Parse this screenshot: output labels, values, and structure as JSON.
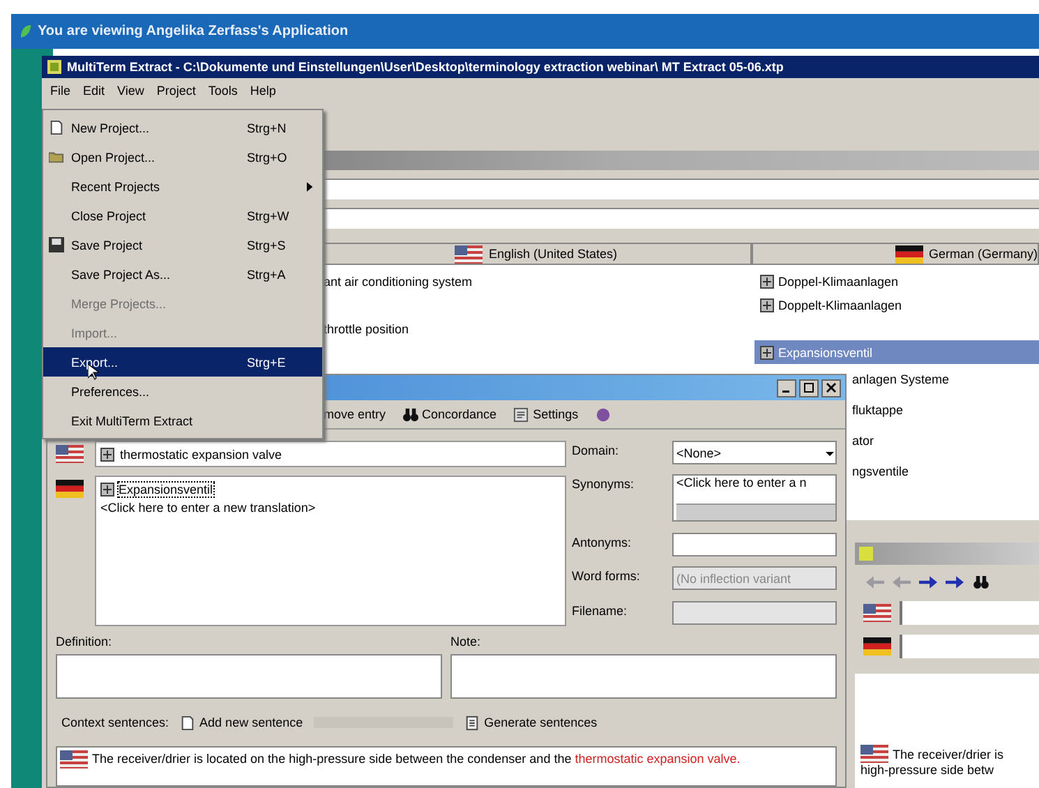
{
  "banner": {
    "title": "You are viewing Angelika Zerfass's Application"
  },
  "window": {
    "title": "MultiTerm Extract - C:\\Dokumente und Einstellungen\\User\\Desktop\\terminology extraction webinar\\ MT Extract 05-06.xtp",
    "menu": [
      "File",
      "Edit",
      "View",
      "Project",
      "Tools",
      "Help"
    ]
  },
  "file_menu": [
    {
      "label": "New Project...",
      "shortcut": "Strg+N",
      "kind": "page",
      "disabled": false,
      "selected": false
    },
    {
      "label": "Open Project...",
      "shortcut": "Strg+O",
      "kind": "folder",
      "disabled": false,
      "selected": false
    },
    {
      "label": "Recent Projects",
      "kind": "submenu",
      "disabled": false,
      "selected": false
    },
    {
      "label": "Close Project",
      "shortcut": "Strg+W",
      "kind": "plain",
      "disabled": false,
      "selected": false
    },
    {
      "label": "Save Project",
      "shortcut": "Strg+S",
      "kind": "disk",
      "disabled": false,
      "selected": false
    },
    {
      "label": "Save Project As...",
      "shortcut": "Strg+A",
      "kind": "plain",
      "disabled": false,
      "selected": false
    },
    {
      "label": "Merge Projects...",
      "kind": "plain",
      "disabled": true,
      "selected": false
    },
    {
      "label": "Import...",
      "kind": "plain",
      "disabled": true,
      "selected": false
    },
    {
      "label": "Export...",
      "shortcut": "Strg+E",
      "kind": "plain",
      "disabled": false,
      "selected": true
    },
    {
      "label": "Preferences...",
      "kind": "plain",
      "disabled": false,
      "selected": false
    },
    {
      "label": "Exit MultiTerm Extract",
      "kind": "plain",
      "disabled": false,
      "selected": false
    }
  ],
  "term_list": {
    "columns": [
      {
        "label": "English (United States)",
        "kind": "us"
      },
      {
        "label": "German (Germany)",
        "kind": "de"
      }
    ],
    "rows": [
      {
        "english": "ant air conditioning system",
        "german": "Doppel-Klimaanlagen",
        "selected": false
      },
      {
        "german": "Doppelt-Klimaanlagen",
        "selected": false
      },
      {
        "english": "throttle position",
        "selected": false
      },
      {
        "german": "Expansionsventil",
        "selected": true
      },
      {
        "german": "anlagen Systeme",
        "kind": "clipped",
        "selected": false
      },
      {
        "german": "fluktappe",
        "kind": "clipped",
        "selected": false
      },
      {
        "german": "ator",
        "kind": "clipped",
        "selected": false
      },
      {
        "german": "ngsventile",
        "kind": "clipped",
        "selected": false
      }
    ]
  },
  "dialog": {
    "toolbar": [
      {
        "label": "move entry",
        "kind": "text"
      },
      {
        "label": "Concordance",
        "kind": "binoculars"
      },
      {
        "label": "Settings",
        "kind": "settings"
      },
      {
        "kind": "orb"
      }
    ],
    "english_term": "thermostatic expansion valve",
    "german_term": "Expansionsventil",
    "new_translation": "<Click here to enter a new translation>",
    "domain_label": "Domain:",
    "domain": "<None>",
    "synonyms_label": "Synonyms:",
    "synonyms": "<Click here to enter a n",
    "antonyms_label": "Antonyms:",
    "word_forms_label": "Word forms:",
    "word_forms": "(No inflection variant",
    "filename_label": "Filename:",
    "definition_label": "Definition:",
    "note_label": "Note:",
    "context_label": "Context sentences:",
    "add_sentence": "Add new sentence",
    "generate": "Generate sentences",
    "sentence": "The receiver/drier is located on the high-pressure side between the condenser and the",
    "sentence_term": "thermostatic expansion valve."
  },
  "side_window": {
    "sentence": "The receiver/drier is",
    "sentence_2": "high-pressure side betw"
  }
}
